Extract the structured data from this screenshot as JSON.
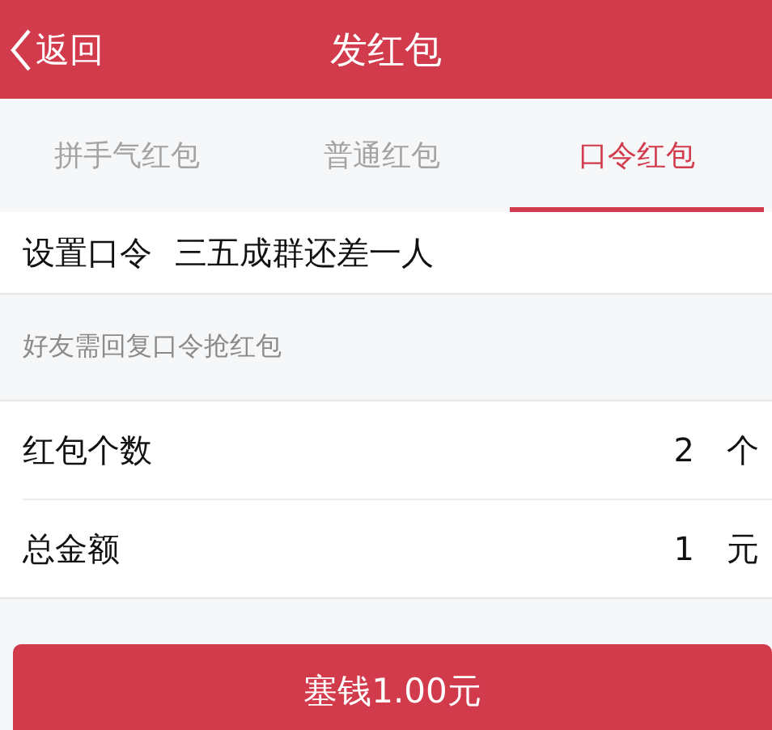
{
  "header": {
    "back": "返回",
    "title": "发红包"
  },
  "tabs": [
    {
      "label": "拼手气红包",
      "selected": false
    },
    {
      "label": "普通红包",
      "selected": false
    },
    {
      "label": "口令红包",
      "selected": true
    }
  ],
  "password": {
    "label": "设置口令",
    "value": "三五成群还差一人"
  },
  "hint": "好友需回复口令抢红包",
  "fields": [
    {
      "label": "红包个数",
      "value": "2",
      "unit": "个"
    },
    {
      "label": "总金额",
      "value": "1",
      "unit": "元"
    }
  ],
  "submit": "塞钱1.00元"
}
